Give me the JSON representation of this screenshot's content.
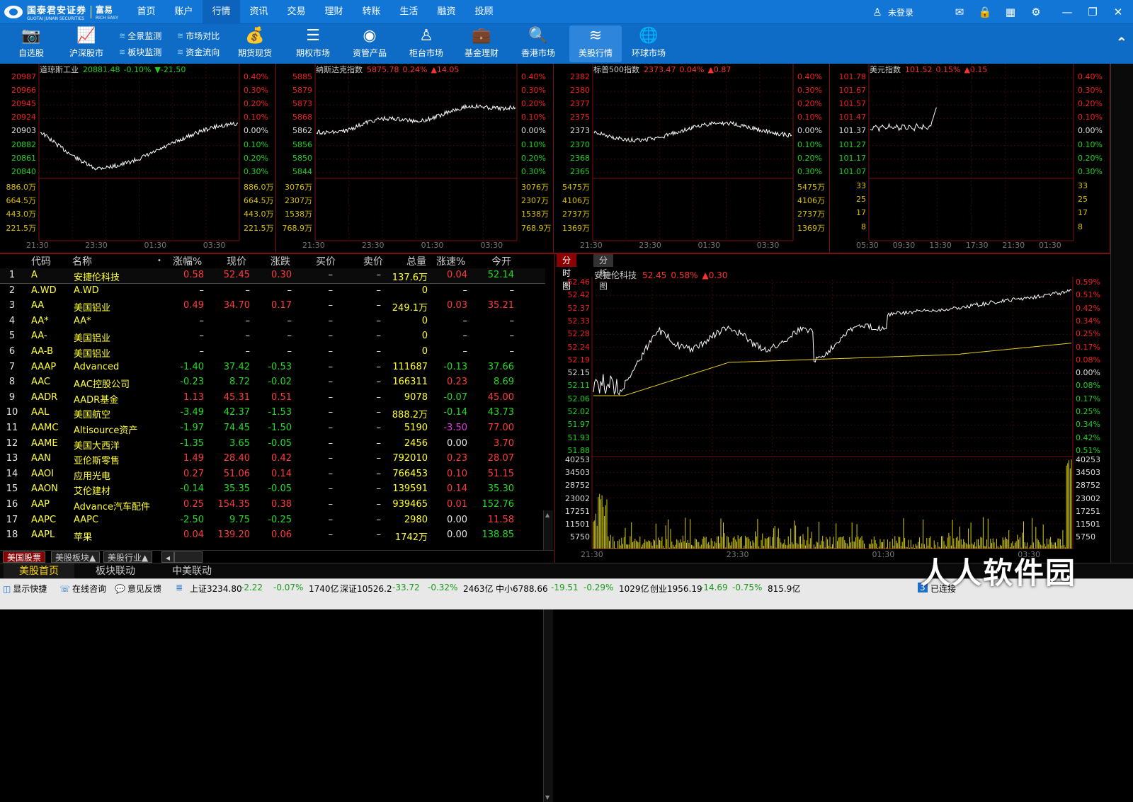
{
  "header": {
    "brand": "国泰君安证券",
    "brand_en": "GUOTAI JUNAN SECURITIES",
    "product": "富易",
    "product_en": "RICH EASY",
    "nav": [
      "首页",
      "账户",
      "行情",
      "资讯",
      "交易",
      "理财",
      "转账",
      "生活",
      "融资",
      "投顾"
    ],
    "active_nav": "行情",
    "login": "未登录"
  },
  "toolbar": {
    "items": [
      "自选股",
      "沪深股市",
      "期货现货",
      "期权市场",
      "资管产品",
      "柜台市场",
      "基金理财",
      "香港市场",
      "美股行情",
      "环球市场"
    ],
    "sub": [
      "全景监测",
      "市场对比",
      "板块监测",
      "资金流向"
    ],
    "active": "美股行情"
  },
  "indices": [
    {
      "name": "道琼斯工业",
      "price": "20881.48",
      "pct": "-0.10%",
      "chg": "▼-21.50",
      "dir": "down",
      "prices": [
        "20987",
        "20966",
        "20945",
        "20924",
        "20903",
        "20882",
        "20861",
        "20840"
      ],
      "vols": [
        "886.0万",
        "664.5万",
        "443.0万",
        "221.5万"
      ],
      "pcts": [
        "0.40%",
        "0.30%",
        "0.20%",
        "0.10%",
        "0.00%",
        "0.10%",
        "0.20%",
        "0.30%"
      ],
      "times": [
        "21:30",
        "23:30",
        "01:30",
        "03:30"
      ]
    },
    {
      "name": "纳斯达克指数",
      "price": "5875.78",
      "pct": "0.24%",
      "chg": "▲14.05",
      "dir": "up",
      "prices": [
        "5885",
        "5879",
        "5873",
        "5868",
        "5862",
        "5856",
        "5850",
        "5844"
      ],
      "vols": [
        "3076万",
        "2307万",
        "1538万",
        "768.9万"
      ],
      "pcts": [
        "0.40%",
        "0.30%",
        "0.20%",
        "0.10%",
        "0.00%",
        "0.10%",
        "0.20%",
        "0.30%"
      ],
      "times": [
        "21:30",
        "23:30",
        "01:30",
        "03:30"
      ]
    },
    {
      "name": "标普500指数",
      "price": "2373.47",
      "pct": "0.04%",
      "chg": "▲0.87",
      "dir": "up",
      "prices": [
        "2382",
        "2380",
        "2377",
        "2375",
        "2373",
        "2370",
        "2368",
        "2365"
      ],
      "vols": [
        "5475万",
        "4106万",
        "2737万",
        "1369万"
      ],
      "pcts": [
        "0.40%",
        "0.30%",
        "0.20%",
        "0.10%",
        "0.00%",
        "0.10%",
        "0.20%",
        "0.30%"
      ],
      "times": [
        "21:30",
        "23:30",
        "01:30",
        "03:30"
      ]
    },
    {
      "name": "美元指数",
      "price": "101.52",
      "pct": "0.15%",
      "chg": "▲0.15",
      "dir": "up",
      "prices": [
        "101.78",
        "101.67",
        "101.57",
        "101.47",
        "101.37",
        "101.27",
        "101.17",
        "101.07"
      ],
      "vols": [
        "33",
        "25",
        "17",
        "8"
      ],
      "pcts": [
        "0.40%",
        "0.30%",
        "0.20%",
        "0.10%",
        "0.00%",
        "0.10%",
        "0.20%",
        "0.30%"
      ],
      "times": [
        "05:30",
        "09:30",
        "13:30",
        "17:30",
        "21:30",
        "01:30"
      ]
    }
  ],
  "list": {
    "headers": [
      "代码",
      "名称",
      "•",
      "涨幅%",
      "现价",
      "涨跌",
      "买价",
      "卖价",
      "总量",
      "涨速%",
      "今开"
    ],
    "rows": [
      [
        "1",
        "A",
        "安捷伦科技",
        "0.58",
        "52.45",
        "0.30",
        "–",
        "–",
        "137.6万",
        "0.04",
        "52.14"
      ],
      [
        "2",
        "A.WD",
        "A.WD",
        "–",
        "–",
        "–",
        "–",
        "–",
        "0",
        "–",
        "–"
      ],
      [
        "3",
        "AA",
        "美国铝业",
        "0.49",
        "34.70",
        "0.17",
        "–",
        "–",
        "249.1万",
        "0.03",
        "35.21"
      ],
      [
        "4",
        "AA*",
        "AA*",
        "–",
        "–",
        "–",
        "–",
        "–",
        "0",
        "–",
        "–"
      ],
      [
        "5",
        "AA-",
        "美国铝业",
        "–",
        "–",
        "–",
        "–",
        "–",
        "0",
        "–",
        "–"
      ],
      [
        "6",
        "AA-B",
        "美国铝业",
        "–",
        "–",
        "–",
        "–",
        "–",
        "0",
        "–",
        "–"
      ],
      [
        "7",
        "AAAP",
        "Advanced",
        "-1.40",
        "37.42",
        "-0.53",
        "–",
        "–",
        "111687",
        "-0.13",
        "37.66"
      ],
      [
        "8",
        "AAC",
        "AAC控股公司",
        "-0.23",
        "8.72",
        "-0.02",
        "–",
        "–",
        "166311",
        "0.23",
        "8.69"
      ],
      [
        "9",
        "AADR",
        "AADR基金",
        "1.13",
        "45.31",
        "0.51",
        "–",
        "–",
        "9078",
        "-0.07",
        "45.00"
      ],
      [
        "10",
        "AAL",
        "美国航空",
        "-3.49",
        "42.37",
        "-1.53",
        "–",
        "–",
        "888.2万",
        "-0.14",
        "43.73"
      ],
      [
        "11",
        "AAMC",
        "Altisource资产",
        "-1.97",
        "74.45",
        "-1.50",
        "–",
        "–",
        "5190",
        "-3.50",
        "77.00"
      ],
      [
        "12",
        "AAME",
        "美国大西洋",
        "-1.35",
        "3.65",
        "-0.05",
        "–",
        "–",
        "2456",
        "0.00",
        "3.70"
      ],
      [
        "13",
        "AAN",
        "亚伦斯零售",
        "1.49",
        "28.40",
        "0.42",
        "–",
        "–",
        "792010",
        "0.23",
        "28.07"
      ],
      [
        "14",
        "AAOI",
        "应用光电",
        "0.27",
        "51.06",
        "0.14",
        "–",
        "–",
        "766453",
        "0.10",
        "51.15"
      ],
      [
        "15",
        "AAON",
        "艾伦建材",
        "-0.14",
        "35.35",
        "-0.05",
        "–",
        "–",
        "139591",
        "0.14",
        "35.30"
      ],
      [
        "16",
        "AAP",
        "Advance汽车配件",
        "0.25",
        "154.35",
        "0.38",
        "–",
        "–",
        "939465",
        "0.01",
        "152.76"
      ],
      [
        "17",
        "AAPC",
        "AAPC",
        "-2.50",
        "9.75",
        "-0.25",
        "–",
        "–",
        "2980",
        "0.00",
        "11.58"
      ],
      [
        "18",
        "AAPL",
        "苹果",
        "0.04",
        "139.20",
        "0.06",
        "–",
        "–",
        "1742万",
        "0.00",
        "138.85"
      ]
    ]
  },
  "bottom_tabs": [
    "美国股票",
    "美股板块▲",
    "美股行业▲"
  ],
  "mode_tabs": [
    "美股首页",
    "板块联动",
    "中美联动"
  ],
  "detail": {
    "tabs": [
      "分时图",
      "分析图"
    ],
    "name": "安捷伦科技",
    "price": "52.45",
    "pct": "0.58%",
    "chg": "▲0.30",
    "prices": [
      "52.46",
      "52.42",
      "52.37",
      "52.33",
      "52.28",
      "52.24",
      "52.19",
      "52.15",
      "52.11",
      "52.06",
      "52.02",
      "51.97",
      "51.93",
      "51.88"
    ],
    "pcts": [
      "0.59%",
      "0.51%",
      "0.42%",
      "0.34%",
      "0.25%",
      "0.17%",
      "0.08%",
      "0.00%",
      "0.08%",
      "0.17%",
      "0.25%",
      "0.34%",
      "0.42%",
      "0.51%"
    ],
    "vols": [
      "40253",
      "34503",
      "28752",
      "23002",
      "17251",
      "11501",
      "5750"
    ],
    "times": [
      "21:30",
      "23:30",
      "01:30",
      "03:30"
    ]
  },
  "status": {
    "items": [
      "显示快捷",
      "在线咨询",
      "意见反馈"
    ],
    "sh": "上证3234.80",
    "sh_chg": "-2.22",
    "sh_pct": "-0.07%",
    "sh_vol": "1740亿",
    "sz": "深证10526.2",
    "sz_chg": "-33.72",
    "sz_pct": "-0.32%",
    "sz_vol": "2463亿",
    "zx": "中小6788.66",
    "zx_chg": "-19.51",
    "zx_pct": "-0.29%",
    "zx_vol": "1029亿",
    "cy": "创业1956.19",
    "cy_chg": "-14.69",
    "cy_pct": "-0.75%",
    "cy_vol": "815.9亿",
    "conn": "已连接"
  },
  "watermark": "人人软件园"
}
